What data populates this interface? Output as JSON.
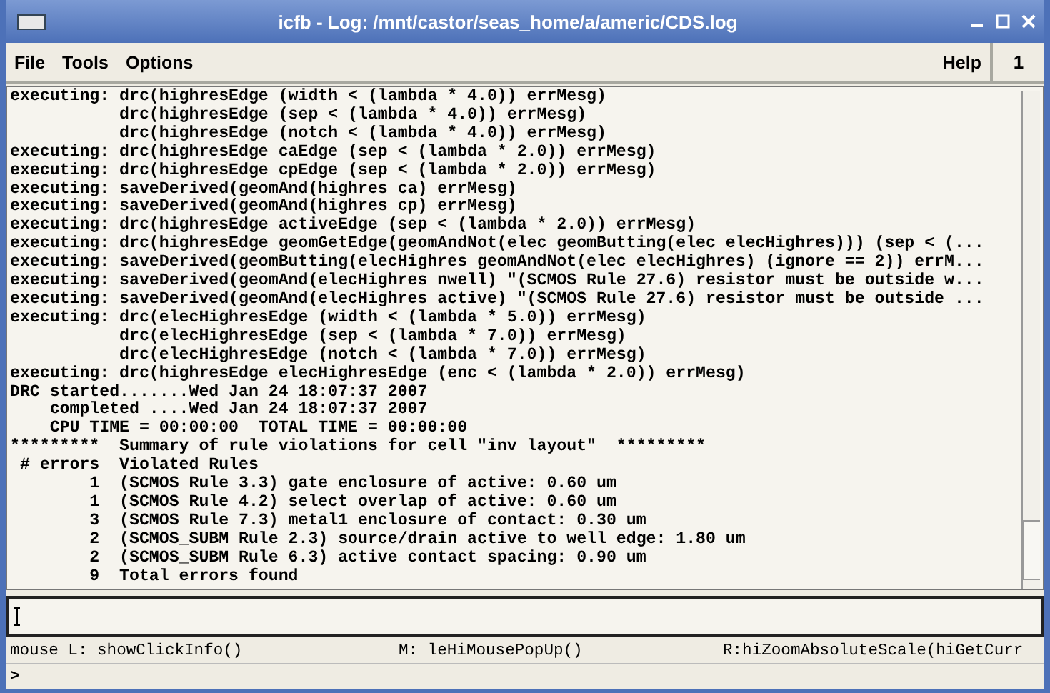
{
  "window": {
    "title": "icfb - Log: /mnt/castor/seas_home/a/americ/CDS.log"
  },
  "menu": [
    {
      "label": "File"
    },
    {
      "label": "Tools"
    },
    {
      "label": "Options"
    }
  ],
  "help_menu": {
    "label": "Help"
  },
  "window_number": "1",
  "log_lines": [
    "executing: drc(highresEdge (width < (lambda * 4.0)) errMesg)",
    "           drc(highresEdge (sep < (lambda * 4.0)) errMesg)",
    "           drc(highresEdge (notch < (lambda * 4.0)) errMesg)",
    "executing: drc(highresEdge caEdge (sep < (lambda * 2.0)) errMesg)",
    "executing: drc(highresEdge cpEdge (sep < (lambda * 2.0)) errMesg)",
    "executing: saveDerived(geomAnd(highres ca) errMesg)",
    "executing: saveDerived(geomAnd(highres cp) errMesg)",
    "executing: drc(highresEdge activeEdge (sep < (lambda * 2.0)) errMesg)",
    "executing: drc(highresEdge geomGetEdge(geomAndNot(elec geomButting(elec elecHighres))) (sep < (...",
    "executing: saveDerived(geomButting(elecHighres geomAndNot(elec elecHighres) (ignore == 2)) errM...",
    "executing: saveDerived(geomAnd(elecHighres nwell) \"(SCMOS Rule 27.6) resistor must be outside w...",
    "executing: saveDerived(geomAnd(elecHighres active) \"(SCMOS Rule 27.6) resistor must be outside ...",
    "executing: drc(elecHighresEdge (width < (lambda * 5.0)) errMesg)",
    "           drc(elecHighresEdge (sep < (lambda * 7.0)) errMesg)",
    "           drc(elecHighresEdge (notch < (lambda * 7.0)) errMesg)",
    "executing: drc(highresEdge elecHighresEdge (enc < (lambda * 2.0)) errMesg)",
    "DRC started.......Wed Jan 24 18:07:37 2007",
    "    completed ....Wed Jan 24 18:07:37 2007",
    "    CPU TIME = 00:00:00  TOTAL TIME = 00:00:00",
    "*********  Summary of rule violations for cell \"inv layout\"  *********",
    " # errors  Violated Rules",
    "        1  (SCMOS Rule 3.3) gate enclosure of active: 0.60 um",
    "        1  (SCMOS Rule 4.2) select overlap of active: 0.60 um",
    "        3  (SCMOS Rule 7.3) metal1 enclosure of contact: 0.30 um",
    "        2  (SCMOS_SUBM Rule 2.3) source/drain active to well edge: 1.80 um",
    "        2  (SCMOS_SUBM Rule 6.3) active contact spacing: 0.90 um",
    "        9  Total errors found"
  ],
  "mouse_bindings": [
    {
      "text": "mouse L: showClickInfo()"
    },
    {
      "text": "M: leHiMousePopUp()"
    },
    {
      "text": "R:hiZoomAbsoluteScale(hiGetCurr"
    }
  ],
  "prompt": ">"
}
